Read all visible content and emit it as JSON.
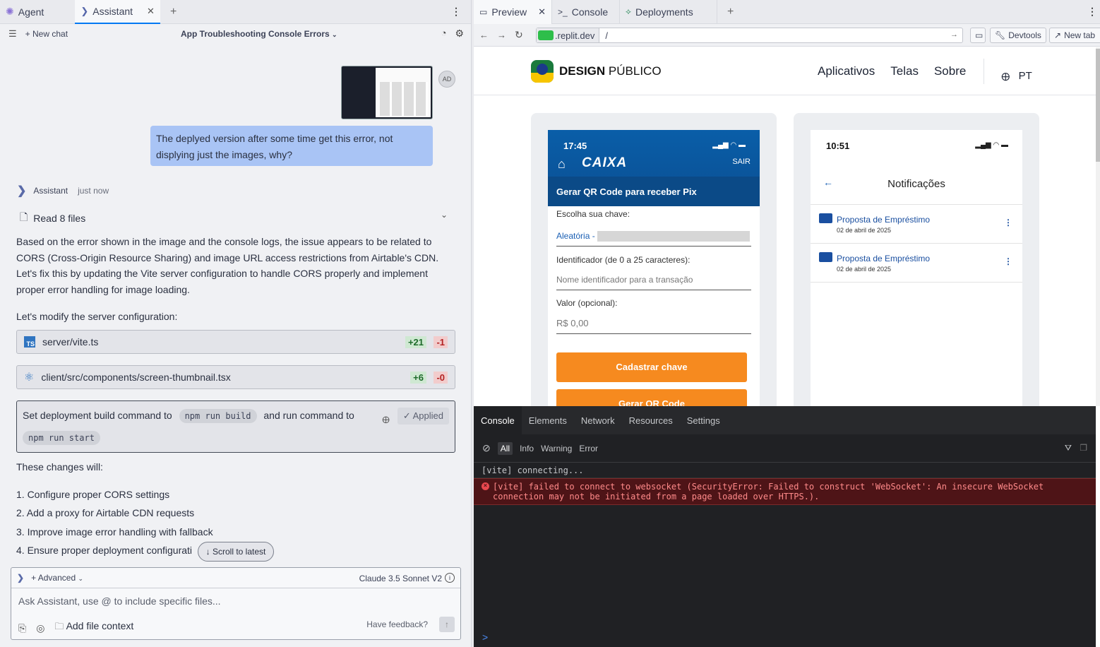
{
  "left": {
    "tabs": [
      {
        "label": "Agent",
        "icon": "agent-icon"
      },
      {
        "label": "Assistant",
        "icon": "assistant-icon",
        "close": "✕"
      }
    ],
    "new_tab": "+",
    "new_chat": "New chat",
    "chat_title": "App Troubleshooting Console Errors",
    "avatar": "AD",
    "user_message": "The deplyed version after some time get this error, not displying just the images, why?",
    "assistant_name": "Assistant",
    "assistant_time": "just now",
    "read_files": "Read 8 files",
    "para1": "Based on the error shown in the image and the console logs, the issue appears to be related to CORS (Cross-Origin Resource Sharing) and image URL access restrictions from Airtable's CDN. Let's fix this by updating the Vite server configuration to handle CORS properly and implement proper error handling for image loading.",
    "para2": "Let's modify the server configuration:",
    "files": [
      {
        "ts_badge": "TS",
        "name": "server/vite.ts",
        "added": "+21",
        "removed": "-1"
      },
      {
        "name": "client/src/components/screen-thumbnail.tsx",
        "added": "+6",
        "removed": "-0"
      }
    ],
    "deploy": {
      "text1": "Set deployment build command to",
      "build_cmd": "npm run build",
      "text2": "and run command to",
      "run_cmd": "npm run start",
      "status": "✓ Applied"
    },
    "changes_heading": "These changes will:",
    "changes": [
      "1. Configure proper CORS settings",
      "2. Add a proxy for Airtable CDN requests",
      "3. Improve image error handling with fallback",
      "4. Ensure proper deployment configurati"
    ],
    "scroll_latest": "↓ Scroll to latest",
    "composer": {
      "mode": "+ Advanced",
      "model": "Claude 3.5 Sonnet V2",
      "placeholder": "Ask Assistant, use @ to include specific files...",
      "add_context": "Add file context",
      "feedback": "Have feedback?"
    }
  },
  "right": {
    "tabs": [
      "Preview",
      "Console",
      "Deployments"
    ],
    "url_host": ".replit.dev",
    "url_path": "/",
    "devtools_btn": "Devtools",
    "newtab_btn": "New tab",
    "site": {
      "brand_bold": "DESIGN",
      "brand_rest": "PÚBLICO",
      "nav": [
        "Aplicativos",
        "Telas",
        "Sobre"
      ],
      "lang": "PT",
      "caixa": {
        "time": "17:45",
        "brand": "CAIXA",
        "sair": "SAIR",
        "heading": "Gerar QR Code para receber Pix",
        "choose_key": "Escolha sua chave:",
        "key_value": "Aleatória - ",
        "id_label": "Identificador (de 0 a 25 caracteres):",
        "id_placeholder": "Nome identificador para a transação",
        "value_label": "Valor (opcional):",
        "value_placeholder": "R$ 0,00",
        "btn1": "Cadastrar chave",
        "btn2": "Gerar QR Code"
      },
      "notif": {
        "time": "10:51",
        "title": "Notificações",
        "items": [
          {
            "title": "Proposta de Empréstimo",
            "date": "02 de abril de 2025"
          },
          {
            "title": "Proposta de Empréstimo",
            "date": "02 de abril de 2025"
          }
        ]
      }
    },
    "devtools": {
      "tabs": [
        "Console",
        "Elements",
        "Network",
        "Resources",
        "Settings"
      ],
      "filters": [
        "All",
        "Info",
        "Warning",
        "Error"
      ],
      "log_info": "[vite] connecting...",
      "log_error": "[vite] failed to connect to websocket (SecurityError: Failed to construct 'WebSocket': An insecure WebSocket connection may not be initiated from a page loaded over HTTPS.).",
      "prompt": ">"
    }
  }
}
